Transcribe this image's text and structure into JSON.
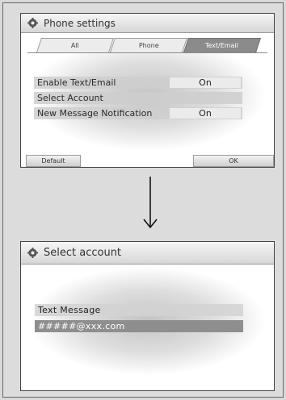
{
  "phone_settings": {
    "title": "Phone settings",
    "tabs": [
      {
        "label": "All",
        "active": false
      },
      {
        "label": "Phone",
        "active": false
      },
      {
        "label": "Text/Email",
        "active": true
      }
    ],
    "rows": [
      {
        "label": "Enable Text/Email",
        "value": "On"
      },
      {
        "label": "Select Account",
        "value": ""
      },
      {
        "label": "New Message Notification",
        "value": "On"
      }
    ],
    "buttons": {
      "default_label": "Default",
      "ok_label": "OK"
    }
  },
  "select_account": {
    "title": "Select account",
    "items": [
      {
        "label": "Text Message",
        "selected": false
      },
      {
        "label": "#####@xxx.com",
        "selected": true
      }
    ]
  },
  "icons": {
    "title_icon": "gear-icon",
    "transition": "arrow-down-icon"
  },
  "colors": {
    "titlebar": "#d6d6d6",
    "active_tab": "#8b8b8b",
    "row": "#cecece",
    "selected_row": "#8e8e8e"
  }
}
